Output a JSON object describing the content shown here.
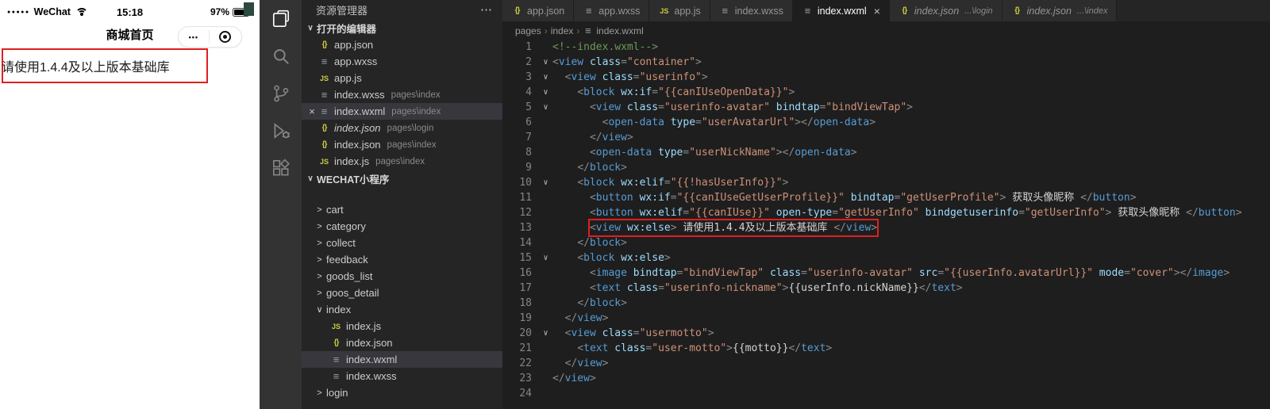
{
  "colors": {
    "highlight_red": "#e01f1f",
    "tag": "#569cd6",
    "attribute": "#9cdcfe",
    "string": "#ce9178",
    "comment": "#6a9955",
    "editor_bg": "#1e1e1e",
    "sidebar_bg": "#252526",
    "activitybar_bg": "#333333",
    "selection_bg": "#37373d"
  },
  "icons": {
    "chevron_down": "∨",
    "chevron_right": ">",
    "close": "×",
    "more_actions": "⋯",
    "breadcrumb_separator": "›",
    "file_generic": "≡",
    "json_braces": "{}",
    "js_badge": "JS",
    "fold_chevron": "∨"
  },
  "simulator": {
    "status_bar": {
      "signal_dots": "●●●●●",
      "carrier": "WeChat",
      "time": "15:18",
      "battery_percent": "97%"
    },
    "nav_bar": {
      "title": "商城首页",
      "more_label": "•••"
    },
    "alert_text": "请使用1.4.4及以上版本基础库"
  },
  "activity_bar": {
    "icons": [
      "files-icon",
      "search-icon",
      "source-control-icon",
      "run-debug-icon",
      "extensions-icon"
    ]
  },
  "sidebar": {
    "title": "资源管理器",
    "open_editors": {
      "label": "打开的编辑器",
      "items": [
        {
          "icon": "json",
          "name": "app.json",
          "path": ""
        },
        {
          "icon": "wxss",
          "name": "app.wxss",
          "path": ""
        },
        {
          "icon": "js",
          "name": "app.js",
          "path": ""
        },
        {
          "icon": "wxss",
          "name": "index.wxss",
          "path": "pages\\index"
        },
        {
          "icon": "wxml",
          "name": "index.wxml",
          "path": "pages\\index",
          "active": true
        },
        {
          "icon": "json",
          "name": "index.json",
          "path": "pages\\login",
          "preview": true
        },
        {
          "icon": "json",
          "name": "index.json",
          "path": "pages\\index"
        },
        {
          "icon": "js",
          "name": "index.js",
          "path": "pages\\index"
        }
      ]
    },
    "workspace": {
      "label": "WECHAT小程序",
      "items": [
        {
          "kind": "folder",
          "name": "cart"
        },
        {
          "kind": "folder",
          "name": "category"
        },
        {
          "kind": "folder",
          "name": "collect"
        },
        {
          "kind": "folder",
          "name": "feedback"
        },
        {
          "kind": "folder",
          "name": "goods_list"
        },
        {
          "kind": "folder",
          "name": "goos_detail"
        },
        {
          "kind": "folder",
          "name": "index",
          "expanded": true
        },
        {
          "kind": "file",
          "icon": "js",
          "name": "index.js",
          "indent": 1
        },
        {
          "kind": "file",
          "icon": "json",
          "name": "index.json",
          "indent": 1
        },
        {
          "kind": "file",
          "icon": "wxml",
          "name": "index.wxml",
          "indent": 1,
          "selected": true
        },
        {
          "kind": "file",
          "icon": "wxss",
          "name": "index.wxss",
          "indent": 1
        },
        {
          "kind": "folder",
          "name": "login"
        }
      ]
    }
  },
  "editor": {
    "tabs": [
      {
        "icon": "json",
        "label": "app.json"
      },
      {
        "icon": "wxss",
        "label": "app.wxss"
      },
      {
        "icon": "js",
        "label": "app.js"
      },
      {
        "icon": "wxss",
        "label": "index.wxss"
      },
      {
        "icon": "wxml",
        "label": "index.wxml",
        "active": true
      },
      {
        "icon": "json",
        "label": "index.json",
        "hint": "...\\login",
        "preview": true
      },
      {
        "icon": "json",
        "label": "index.json",
        "hint": "...\\index",
        "preview": true
      }
    ],
    "breadcrumbs": [
      "pages",
      "index",
      "index.wxml"
    ],
    "code": {
      "highlight_line": 13,
      "fold_lines": [
        2,
        3,
        4,
        5,
        10,
        15,
        20
      ],
      "lines": [
        {
          "ind": 0,
          "tok": [
            [
              "cm",
              "<!--index.wxml-->"
            ]
          ]
        },
        {
          "ind": 0,
          "tok": [
            [
              "pu",
              "<"
            ],
            [
              "tg",
              "view"
            ],
            [
              "at",
              " class"
            ],
            [
              "pu",
              "="
            ],
            [
              "st",
              "\"container\""
            ],
            [
              "pu",
              ">"
            ]
          ]
        },
        {
          "ind": 2,
          "tok": [
            [
              "pu",
              "<"
            ],
            [
              "tg",
              "view"
            ],
            [
              "at",
              " class"
            ],
            [
              "pu",
              "="
            ],
            [
              "st",
              "\"userinfo\""
            ],
            [
              "pu",
              ">"
            ]
          ]
        },
        {
          "ind": 4,
          "tok": [
            [
              "pu",
              "<"
            ],
            [
              "tg",
              "block"
            ],
            [
              "at",
              " wx:if"
            ],
            [
              "pu",
              "="
            ],
            [
              "st",
              "\"{{canIUseOpenData}}\""
            ],
            [
              "pu",
              ">"
            ]
          ]
        },
        {
          "ind": 6,
          "tok": [
            [
              "pu",
              "<"
            ],
            [
              "tg",
              "view"
            ],
            [
              "at",
              " class"
            ],
            [
              "pu",
              "="
            ],
            [
              "st",
              "\"userinfo-avatar\""
            ],
            [
              "at",
              " bindtap"
            ],
            [
              "pu",
              "="
            ],
            [
              "st",
              "\"bindViewTap\""
            ],
            [
              "pu",
              ">"
            ]
          ]
        },
        {
          "ind": 8,
          "tok": [
            [
              "pu",
              "<"
            ],
            [
              "tg",
              "open-data"
            ],
            [
              "at",
              " type"
            ],
            [
              "pu",
              "="
            ],
            [
              "st",
              "\"userAvatarUrl\""
            ],
            [
              "pu",
              "></"
            ],
            [
              "tg",
              "open-data"
            ],
            [
              "pu",
              ">"
            ]
          ]
        },
        {
          "ind": 6,
          "tok": [
            [
              "pu",
              "</"
            ],
            [
              "tg",
              "view"
            ],
            [
              "pu",
              ">"
            ]
          ]
        },
        {
          "ind": 6,
          "tok": [
            [
              "pu",
              "<"
            ],
            [
              "tg",
              "open-data"
            ],
            [
              "at",
              " type"
            ],
            [
              "pu",
              "="
            ],
            [
              "st",
              "\"userNickName\""
            ],
            [
              "pu",
              "></"
            ],
            [
              "tg",
              "open-data"
            ],
            [
              "pu",
              ">"
            ]
          ]
        },
        {
          "ind": 4,
          "tok": [
            [
              "pu",
              "</"
            ],
            [
              "tg",
              "block"
            ],
            [
              "pu",
              ">"
            ]
          ]
        },
        {
          "ind": 4,
          "tok": [
            [
              "pu",
              "<"
            ],
            [
              "tg",
              "block"
            ],
            [
              "at",
              " wx:elif"
            ],
            [
              "pu",
              "="
            ],
            [
              "st",
              "\"{{!hasUserInfo}}\""
            ],
            [
              "pu",
              ">"
            ]
          ]
        },
        {
          "ind": 6,
          "tok": [
            [
              "pu",
              "<"
            ],
            [
              "tg",
              "button"
            ],
            [
              "at",
              " wx:if"
            ],
            [
              "pu",
              "="
            ],
            [
              "st",
              "\"{{canIUseGetUserProfile}}\""
            ],
            [
              "at",
              " bindtap"
            ],
            [
              "pu",
              "="
            ],
            [
              "st",
              "\"getUserProfile\""
            ],
            [
              "pu",
              ">"
            ],
            [
              "tx",
              " 获取头像昵称 "
            ],
            [
              "pu",
              "</"
            ],
            [
              "tg",
              "button"
            ],
            [
              "pu",
              ">"
            ]
          ]
        },
        {
          "ind": 6,
          "tok": [
            [
              "pu",
              "<"
            ],
            [
              "tg",
              "button"
            ],
            [
              "at",
              " wx:elif"
            ],
            [
              "pu",
              "="
            ],
            [
              "st",
              "\"{{canIUse}}\""
            ],
            [
              "at",
              " open-type"
            ],
            [
              "pu",
              "="
            ],
            [
              "st",
              "\"getUserInfo\""
            ],
            [
              "at",
              " bindgetuserinfo"
            ],
            [
              "pu",
              "="
            ],
            [
              "st",
              "\"getUserInfo\""
            ],
            [
              "pu",
              ">"
            ],
            [
              "tx",
              " 获取头像昵称 "
            ],
            [
              "pu",
              "</"
            ],
            [
              "tg",
              "button"
            ],
            [
              "pu",
              ">"
            ]
          ]
        },
        {
          "ind": 6,
          "tok": [
            [
              "pu",
              "<"
            ],
            [
              "tg",
              "view"
            ],
            [
              "at",
              " wx:else"
            ],
            [
              "pu",
              ">"
            ],
            [
              "tx",
              " 请使用1.4.4及以上版本基础库 "
            ],
            [
              "pu",
              "</"
            ],
            [
              "tg",
              "view"
            ],
            [
              "pu",
              ">"
            ]
          ]
        },
        {
          "ind": 4,
          "tok": [
            [
              "pu",
              "</"
            ],
            [
              "tg",
              "block"
            ],
            [
              "pu",
              ">"
            ]
          ]
        },
        {
          "ind": 4,
          "tok": [
            [
              "pu",
              "<"
            ],
            [
              "tg",
              "block"
            ],
            [
              "at",
              " wx:else"
            ],
            [
              "pu",
              ">"
            ]
          ]
        },
        {
          "ind": 6,
          "tok": [
            [
              "pu",
              "<"
            ],
            [
              "tg",
              "image"
            ],
            [
              "at",
              " bindtap"
            ],
            [
              "pu",
              "="
            ],
            [
              "st",
              "\"bindViewTap\""
            ],
            [
              "at",
              " class"
            ],
            [
              "pu",
              "="
            ],
            [
              "st",
              "\"userinfo-avatar\""
            ],
            [
              "at",
              " src"
            ],
            [
              "pu",
              "="
            ],
            [
              "st",
              "\"{{userInfo.avatarUrl}}\""
            ],
            [
              "at",
              " mode"
            ],
            [
              "pu",
              "="
            ],
            [
              "st",
              "\"cover\""
            ],
            [
              "pu",
              "></"
            ],
            [
              "tg",
              "image"
            ],
            [
              "pu",
              ">"
            ]
          ]
        },
        {
          "ind": 6,
          "tok": [
            [
              "pu",
              "<"
            ],
            [
              "tg",
              "text"
            ],
            [
              "at",
              " class"
            ],
            [
              "pu",
              "="
            ],
            [
              "st",
              "\"userinfo-nickname\""
            ],
            [
              "pu",
              ">"
            ],
            [
              "tx",
              "{{userInfo.nickName}}"
            ],
            [
              "pu",
              "</"
            ],
            [
              "tg",
              "text"
            ],
            [
              "pu",
              ">"
            ]
          ]
        },
        {
          "ind": 4,
          "tok": [
            [
              "pu",
              "</"
            ],
            [
              "tg",
              "block"
            ],
            [
              "pu",
              ">"
            ]
          ]
        },
        {
          "ind": 2,
          "tok": [
            [
              "pu",
              "</"
            ],
            [
              "tg",
              "view"
            ],
            [
              "pu",
              ">"
            ]
          ]
        },
        {
          "ind": 2,
          "tok": [
            [
              "pu",
              "<"
            ],
            [
              "tg",
              "view"
            ],
            [
              "at",
              " class"
            ],
            [
              "pu",
              "="
            ],
            [
              "st",
              "\"usermotto\""
            ],
            [
              "pu",
              ">"
            ]
          ]
        },
        {
          "ind": 4,
          "tok": [
            [
              "pu",
              "<"
            ],
            [
              "tg",
              "text"
            ],
            [
              "at",
              " class"
            ],
            [
              "pu",
              "="
            ],
            [
              "st",
              "\"user-motto\""
            ],
            [
              "pu",
              ">"
            ],
            [
              "tx",
              "{{motto}}"
            ],
            [
              "pu",
              "</"
            ],
            [
              "tg",
              "text"
            ],
            [
              "pu",
              ">"
            ]
          ]
        },
        {
          "ind": 2,
          "tok": [
            [
              "pu",
              "</"
            ],
            [
              "tg",
              "view"
            ],
            [
              "pu",
              ">"
            ]
          ]
        },
        {
          "ind": 0,
          "tok": [
            [
              "pu",
              "</"
            ],
            [
              "tg",
              "view"
            ],
            [
              "pu",
              ">"
            ]
          ]
        },
        {
          "ind": 0,
          "tok": []
        }
      ]
    }
  }
}
